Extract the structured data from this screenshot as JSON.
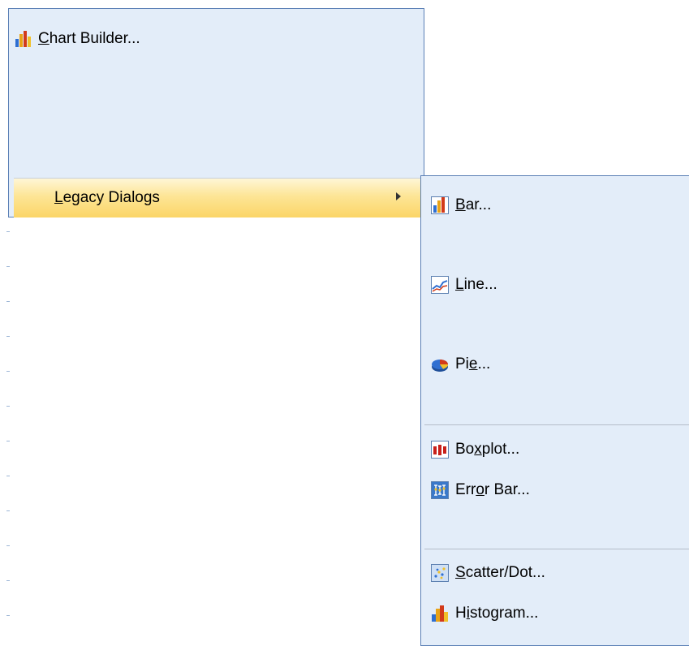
{
  "main_menu": {
    "chart_builder": {
      "label": "Chart Builder...",
      "mnemonic": "C",
      "rest": "hart Builder...",
      "icon": "chart-builder-icon"
    },
    "legacy_dialogs": {
      "label": "Legacy Dialogs",
      "mnemonic": "L",
      "rest": "egacy Dialogs",
      "icon": "submenu-arrow-icon"
    }
  },
  "legacy_submenu": {
    "items": [
      {
        "label": "Bar...",
        "pre": "",
        "mnemonic": "B",
        "post": "ar...",
        "icon": "bar-chart-icon"
      },
      {
        "label": "Line...",
        "pre": "",
        "mnemonic": "L",
        "post": "ine...",
        "icon": "line-chart-icon"
      },
      {
        "label": "Pie...",
        "pre": "Pi",
        "mnemonic": "e",
        "post": "...",
        "icon": "pie-chart-icon"
      },
      {
        "label": "Boxplot...",
        "pre": "Bo",
        "mnemonic": "x",
        "post": "plot...",
        "icon": "boxplot-icon"
      },
      {
        "label": "Error Bar...",
        "pre": "Err",
        "mnemonic": "o",
        "post": "r Bar...",
        "icon": "error-bar-icon"
      },
      {
        "label": "Scatter/Dot...",
        "pre": "",
        "mnemonic": "S",
        "post": "catter/Dot...",
        "icon": "scatter-icon"
      },
      {
        "label": "Histogram...",
        "pre": "H",
        "mnemonic": "i",
        "post": "stogram...",
        "icon": "histogram-icon"
      }
    ]
  },
  "colors": {
    "menu_bg": "#e3edf9",
    "menu_border": "#5a7fb5",
    "highlight": "#fde596"
  }
}
